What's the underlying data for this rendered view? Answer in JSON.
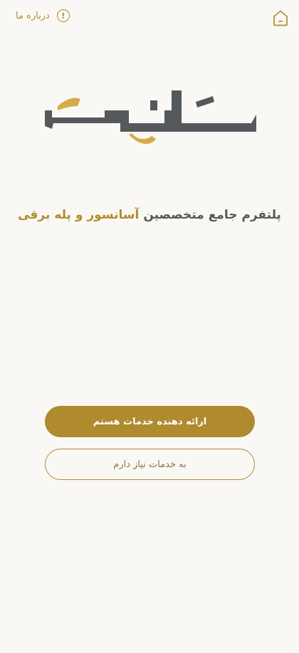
{
  "topbar": {
    "about_label": "درباره ما",
    "about_icon": "info-icon",
    "home_icon": "home-icon"
  },
  "brand": {
    "logo_text": "سِرلیفت",
    "colors": {
      "gold": "#b08a2e",
      "dark": "#55595b",
      "background": "#faf8f5"
    }
  },
  "tagline": {
    "prefix": "پلتفرم جامع متخصصین",
    "highlight": "آسانسور و پله برقی"
  },
  "actions": {
    "provider_label": "ارائه دهنده خدمات هستم",
    "customer_label": "به خدمات نیاز دارم"
  }
}
